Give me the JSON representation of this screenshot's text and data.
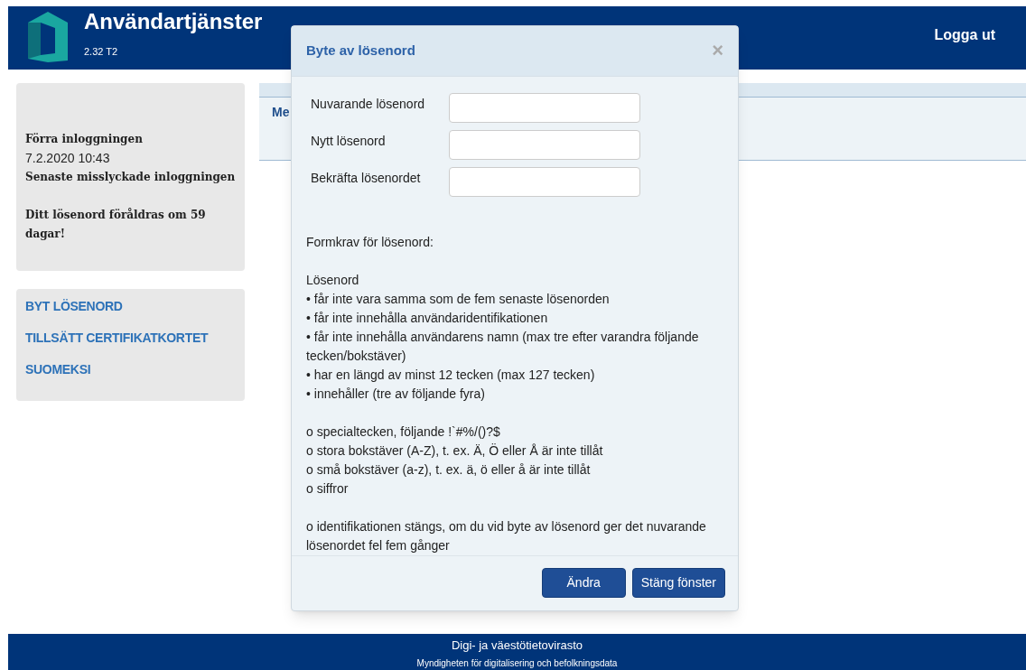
{
  "header": {
    "title": "Användartjänster",
    "version": "2.32 T2",
    "logout": "Logga ut"
  },
  "sidebar": {
    "info": [
      {
        "text": "Förra inloggningen",
        "bold": true
      },
      {
        "text": "7.2.2020 10:43",
        "bold": false
      },
      {
        "text": "Senaste misslyckade inloggningen",
        "bold": true
      }
    ],
    "warning": "Ditt lösenord föråldras om 59 dagar!",
    "links": [
      "BYT LÖSENORD",
      "TILLSÄTT CERTIFIKATKORTET",
      "SUOMEKSI"
    ]
  },
  "content": {
    "tab_label": "Me"
  },
  "dialog": {
    "title": "Byte av lösenord",
    "close": "×",
    "fields": [
      {
        "label": "Nuvarande lösenord"
      },
      {
        "label": "Nytt lösenord"
      },
      {
        "label": "Bekräfta lösenordet"
      }
    ],
    "requirements": [
      [
        "Formkrav för lösenord:"
      ],
      [
        "Lösenord",
        "• får inte vara samma som de fem senaste lösenorden",
        "• får inte innehålla användaridentifikationen",
        "• får inte innehålla användarens namn (max tre efter varandra följande tecken/bokstäver)",
        "• har en längd av minst 12 tecken (max 127 tecken)",
        "• innehåller (tre av följande fyra)"
      ],
      [
        "o specialtecken, följande !`#%/()?$",
        "o stora bokstäver (A-Z), t. ex. Ä, Ö eller Å är inte tillåt",
        "o små bokstäver (a-z), t. ex. ä, ö eller å är inte tillåt",
        "o siffror"
      ],
      [
        "o identifikationen stängs, om du vid byte av lösenord ger det nuvarande lösenordet fel fem gånger"
      ]
    ],
    "buttons": [
      "Ändra",
      "Stäng fönster"
    ]
  },
  "footer": {
    "name": "Digi- ja väestötietovirasto",
    "subtitle": "Myndigheten för digitalisering och befolkningsdata"
  }
}
